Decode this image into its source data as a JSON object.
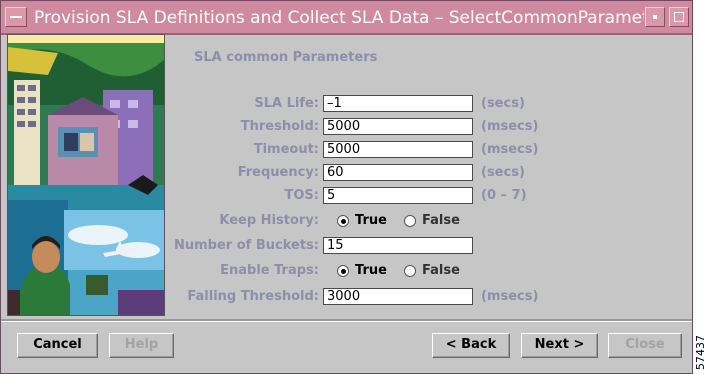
{
  "window": {
    "title": "Provision SLA Definitions and Collect SLA Data – SelectCommonParameters"
  },
  "form": {
    "section_title": "SLA common Parameters",
    "fields": [
      {
        "label": "SLA Life:",
        "value": "–1",
        "unit": "(secs)"
      },
      {
        "label": "Threshold:",
        "value": "5000",
        "unit": "(msecs)"
      },
      {
        "label": "Timeout:",
        "value": "5000",
        "unit": "(msecs)"
      },
      {
        "label": "Frequency:",
        "value": "60",
        "unit": "(secs)"
      },
      {
        "label": "TOS:",
        "value": "5",
        "unit": "(0 – 7)"
      }
    ],
    "keep_history": {
      "label": "Keep History:",
      "options": [
        "True",
        "False"
      ],
      "selected": "True"
    },
    "buckets": {
      "label": "Number of Buckets:",
      "value": "15"
    },
    "enable_traps": {
      "label": "Enable Traps:",
      "options": [
        "True",
        "False"
      ],
      "selected": "True"
    },
    "falling": {
      "label": "Falling Threshold:",
      "value": "3000",
      "unit": "(msecs)"
    }
  },
  "buttons": {
    "cancel": "Cancel",
    "help": "Help",
    "back": "< Back",
    "next": "Next >",
    "close": "Close"
  },
  "figure_number": "57437",
  "colors": {
    "titlebar": "#cf8a9f",
    "label": "#8e8eab",
    "background": "#c6c6c6"
  }
}
